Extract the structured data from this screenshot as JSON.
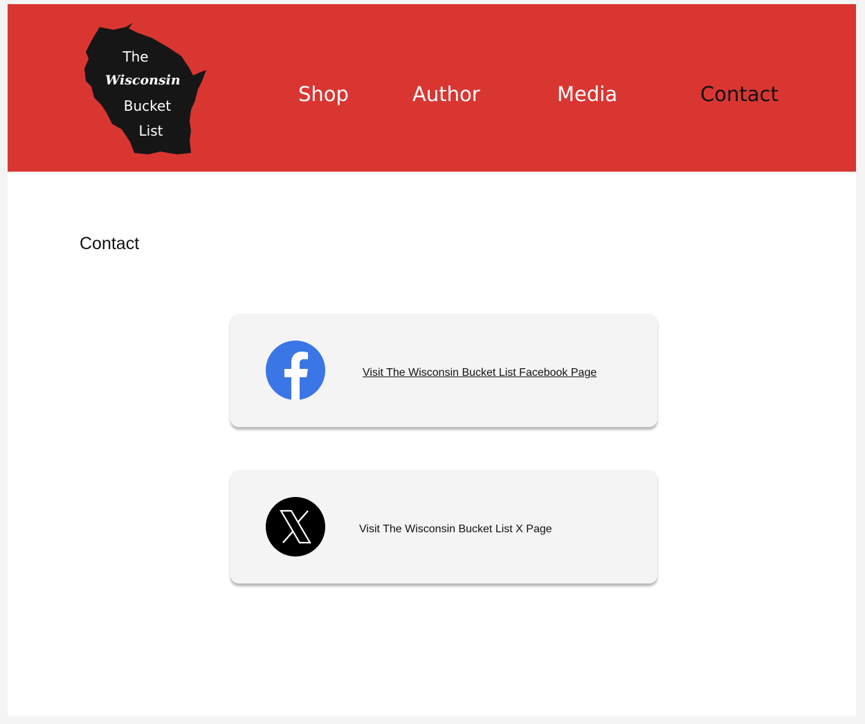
{
  "header": {
    "logo": {
      "line1": "The",
      "line2": "Wisconsin",
      "line3": "Bucket",
      "line4": "List"
    },
    "nav": [
      {
        "label": "Shop"
      },
      {
        "label": "Author"
      },
      {
        "label": "Media"
      },
      {
        "label": "Contact",
        "active": true
      }
    ]
  },
  "main": {
    "title": "Contact",
    "cards": [
      {
        "icon": "facebook-icon",
        "link_text": "Visit The Wisconsin Bucket List Facebook Page"
      },
      {
        "icon": "x-logo-icon",
        "link_text": "Visit The Wisconsin Bucket List X Page"
      }
    ]
  },
  "colors": {
    "header_bg": "#d93632",
    "facebook_blue": "#3b76e6",
    "card_bg": "#f5f4f5",
    "active_nav": "#111111"
  }
}
